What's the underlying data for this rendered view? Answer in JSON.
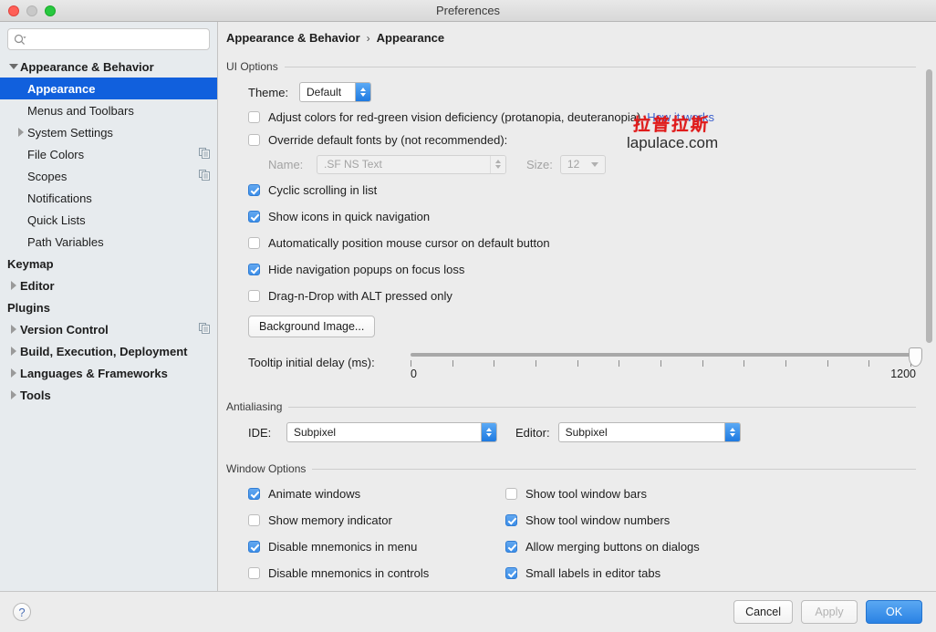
{
  "window": {
    "title": "Preferences",
    "traffic_lights": [
      "close-button",
      "minimize-button",
      "zoom-button"
    ]
  },
  "sidebar": {
    "search": {
      "value": "",
      "placeholder": ""
    },
    "items": [
      {
        "label": "Appearance & Behavior",
        "level": 0,
        "twisty": "down",
        "bold": true,
        "selected": false,
        "copy_icon": false
      },
      {
        "label": "Appearance",
        "level": 1,
        "twisty": "none",
        "bold": true,
        "selected": true,
        "copy_icon": false
      },
      {
        "label": "Menus and Toolbars",
        "level": 1,
        "twisty": "none",
        "bold": false,
        "selected": false,
        "copy_icon": false
      },
      {
        "label": "System Settings",
        "level": 1,
        "twisty": "right",
        "bold": false,
        "selected": false,
        "copy_icon": false
      },
      {
        "label": "File Colors",
        "level": 1,
        "twisty": "none",
        "bold": false,
        "selected": false,
        "copy_icon": true
      },
      {
        "label": "Scopes",
        "level": 1,
        "twisty": "none",
        "bold": false,
        "selected": false,
        "copy_icon": true
      },
      {
        "label": "Notifications",
        "level": 1,
        "twisty": "none",
        "bold": false,
        "selected": false,
        "copy_icon": false
      },
      {
        "label": "Quick Lists",
        "level": 1,
        "twisty": "none",
        "bold": false,
        "selected": false,
        "copy_icon": false
      },
      {
        "label": "Path Variables",
        "level": 1,
        "twisty": "none",
        "bold": false,
        "selected": false,
        "copy_icon": false
      },
      {
        "label": "Keymap",
        "level": 0,
        "twisty": "none",
        "bold": true,
        "selected": false,
        "copy_icon": false
      },
      {
        "label": "Editor",
        "level": 0,
        "twisty": "right",
        "bold": true,
        "selected": false,
        "copy_icon": false
      },
      {
        "label": "Plugins",
        "level": 0,
        "twisty": "none",
        "bold": true,
        "selected": false,
        "copy_icon": false
      },
      {
        "label": "Version Control",
        "level": 0,
        "twisty": "right",
        "bold": true,
        "selected": false,
        "copy_icon": true
      },
      {
        "label": "Build, Execution, Deployment",
        "level": 0,
        "twisty": "right",
        "bold": true,
        "selected": false,
        "copy_icon": false
      },
      {
        "label": "Languages & Frameworks",
        "level": 0,
        "twisty": "right",
        "bold": true,
        "selected": false,
        "copy_icon": false
      },
      {
        "label": "Tools",
        "level": 0,
        "twisty": "right",
        "bold": true,
        "selected": false,
        "copy_icon": false
      }
    ]
  },
  "breadcrumb": {
    "root": "Appearance & Behavior",
    "separator": "›",
    "leaf": "Appearance"
  },
  "ui_options": {
    "group_title": "UI Options",
    "theme_label": "Theme:",
    "theme_value": "Default",
    "color_deficiency": {
      "label": "Adjust colors for red-green vision deficiency (protanopia, deuteranopia)",
      "checked": false,
      "link": "How it works"
    },
    "override_fonts": {
      "label": "Override default fonts by (not recommended):",
      "checked": false
    },
    "font_name_label": "Name:",
    "font_name_value": ".SF NS Text",
    "font_size_label": "Size:",
    "font_size_value": "12",
    "checkboxes": [
      {
        "label": "Cyclic scrolling in list",
        "checked": true
      },
      {
        "label": "Show icons in quick navigation",
        "checked": true
      },
      {
        "label": "Automatically position mouse cursor on default button",
        "checked": false
      },
      {
        "label": "Hide navigation popups on focus loss",
        "checked": true
      },
      {
        "label": "Drag-n-Drop with ALT pressed only",
        "checked": false
      }
    ],
    "background_image_button": "Background Image...",
    "tooltip_delay": {
      "label": "Tooltip initial delay (ms):",
      "min": "0",
      "max": "1200",
      "value": 1200,
      "tick_count": 13
    }
  },
  "antialiasing": {
    "group_title": "Antialiasing",
    "ide_label": "IDE:",
    "ide_value": "Subpixel",
    "editor_label": "Editor:",
    "editor_value": "Subpixel"
  },
  "window_options": {
    "group_title": "Window Options",
    "left_column": [
      {
        "label": "Animate windows",
        "checked": true
      },
      {
        "label": "Show memory indicator",
        "checked": false
      },
      {
        "label": "Disable mnemonics in menu",
        "checked": true
      },
      {
        "label": "Disable mnemonics in controls",
        "checked": false
      }
    ],
    "right_column": [
      {
        "label": "Show tool window bars",
        "checked": false
      },
      {
        "label": "Show tool window numbers",
        "checked": true
      },
      {
        "label": "Allow merging buttons on dialogs",
        "checked": true
      },
      {
        "label": "Small labels in editor tabs",
        "checked": true
      }
    ]
  },
  "watermark": {
    "cn": "拉普拉斯",
    "en": "lapulace.com",
    "color": "#e01b1b"
  },
  "footer": {
    "help_label": "?",
    "cancel_label": "Cancel",
    "apply_label": "Apply",
    "ok_label": "OK"
  },
  "colors": {
    "selection": "#1160dd",
    "accent": "#2a82e4",
    "sidebar_bg": "#e7ebee",
    "panel_bg": "#ececec"
  }
}
